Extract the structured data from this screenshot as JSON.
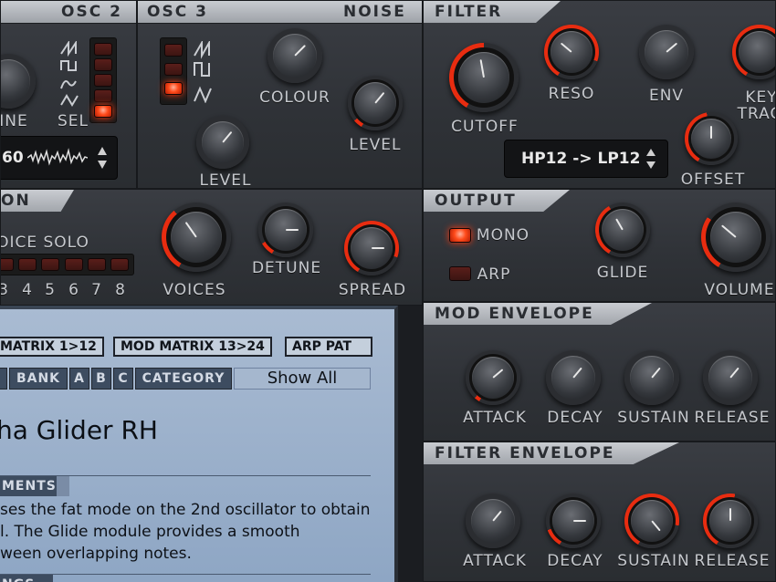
{
  "osc2": {
    "title": "OSC 2",
    "fine_label": "INE",
    "sel_label": "SEL",
    "wave_value": "60",
    "leds": [
      false,
      false,
      false,
      false,
      true
    ]
  },
  "osc3": {
    "title": "OSC 3",
    "colour_label": "COLOUR",
    "level_label": "LEVEL",
    "leds": [
      false,
      false,
      true
    ]
  },
  "noise": {
    "title": "NOISE",
    "level_label": "LEVEL"
  },
  "filter": {
    "title": "FILTER",
    "cutoff_label": "CUTOFF",
    "reso_label": "RESO",
    "env_label": "ENV",
    "key_label": "KEY",
    "track_label": "TRAC",
    "offset_label": "OFFSET",
    "mode_value": "HP12 -> LP12"
  },
  "voice": {
    "title": "ON",
    "solo_label": "OICE SOLO",
    "voices_label": "VOICES",
    "detune_label": "DETUNE",
    "spread_label": "SPREAD",
    "numbers": [
      "3",
      "4",
      "5",
      "6",
      "7",
      "8"
    ]
  },
  "output": {
    "title": "OUTPUT",
    "mono_label": "MONO",
    "arp_label": "ARP",
    "glide_label": "GLIDE",
    "volume_label": "VOLUME",
    "mono_on": true,
    "arp_on": false
  },
  "mod_env": {
    "title": "MOD ENVELOPE",
    "attack": "ATTACK",
    "decay": "DECAY",
    "sustain": "SUSTAIN",
    "release": "RELEASE"
  },
  "filter_env": {
    "title": "FILTER ENVELOPE",
    "attack": "ATTACK",
    "decay": "DECAY",
    "sustain": "SUSTAIN",
    "release": "RELEASE"
  },
  "browser": {
    "tabs": [
      "MATRIX 1>12",
      "MOD MATRIX 13>24",
      "ARP PAT"
    ],
    "filter_buttons": [
      "BANK",
      "A",
      "B",
      "C",
      "CATEGORY"
    ],
    "category_value": "Show All",
    "preset_name": "ha Glider RH",
    "comments_label": "MENTS",
    "comment_lines": [
      "ses the fat mode on the 2nd oscillator to obtain",
      "l. The Glide module provides a smooth",
      "ween overlapping notes."
    ],
    "settings_label": "NGS"
  },
  "colors": {
    "accent_red": "#ff3a10",
    "panel": "#2f3237",
    "browser": "#9cb1cc"
  }
}
